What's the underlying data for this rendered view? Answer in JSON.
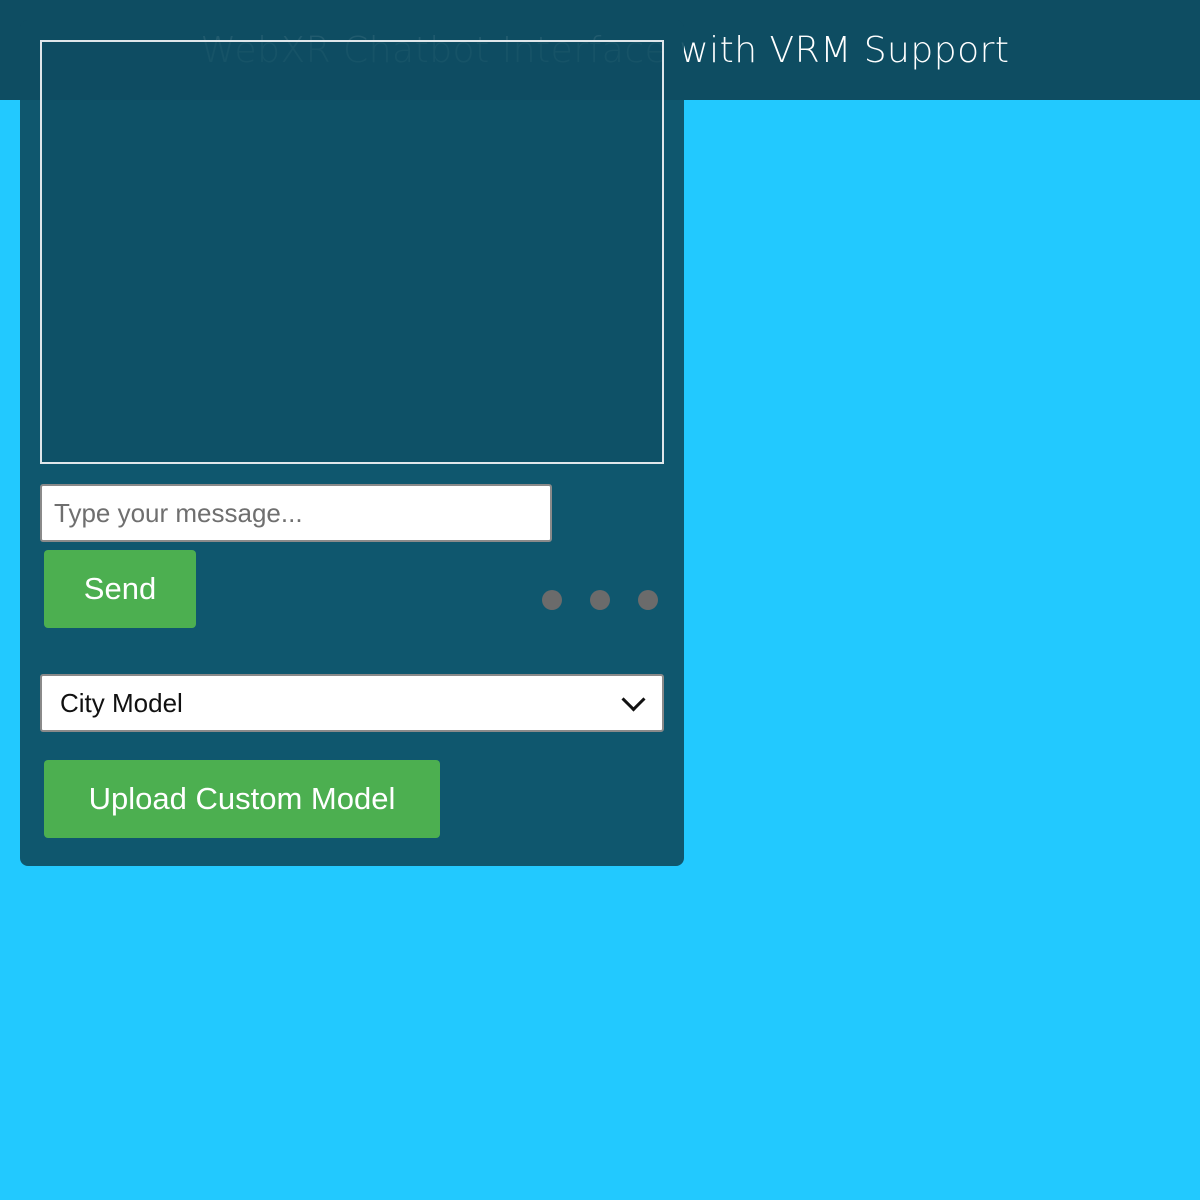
{
  "header": {
    "title": "WebXR Chatbot Interface with VRM Support"
  },
  "chat": {
    "input_placeholder": "Type your message...",
    "input_value": "",
    "send_label": "Send",
    "typing_indicator": "..."
  },
  "model": {
    "selected": "City Model",
    "upload_label": "Upload Custom Model"
  },
  "colors": {
    "background": "#22c9ff",
    "header": "#0e4d62",
    "panel": "#0e4d62",
    "button": "#4caf50",
    "typing_dot": "#6b6b6b"
  }
}
